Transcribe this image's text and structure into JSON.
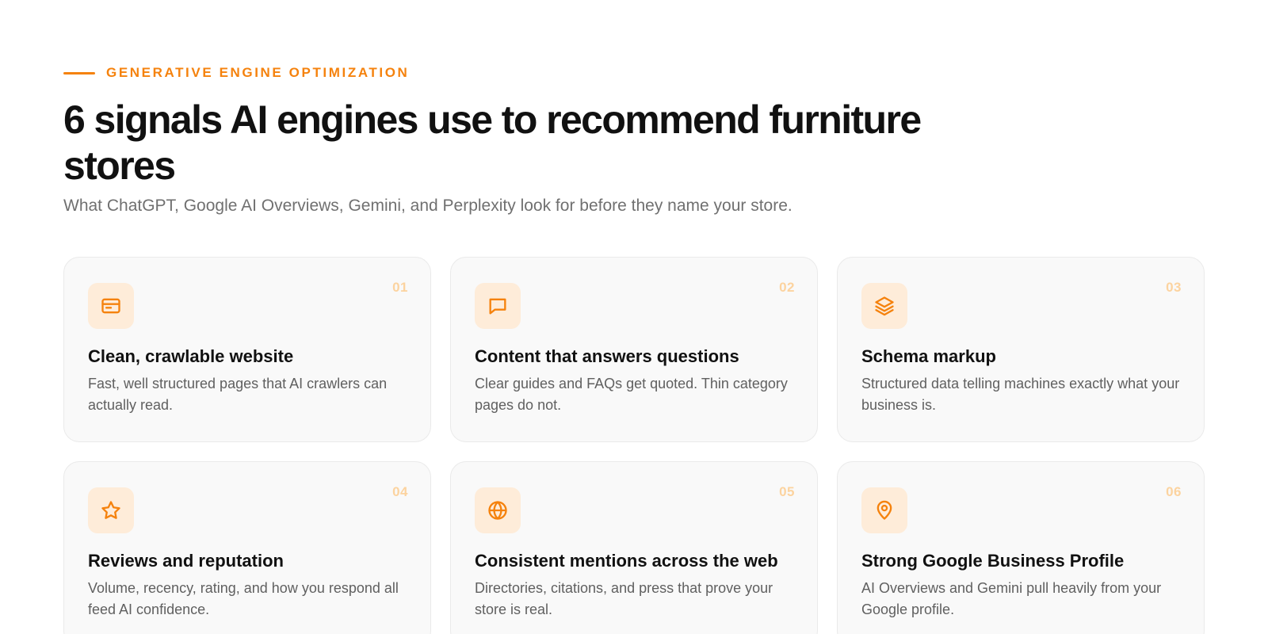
{
  "eyebrow": "GENERATIVE ENGINE OPTIMIZATION",
  "title": "6 signals AI engines use to recommend furniture stores",
  "subtitle": "What ChatGPT, Google AI Overviews, Gemini, and Perplexity look for before they name your store.",
  "colors": {
    "accent": "#f5820d",
    "accent_soft": "#feecd9",
    "number": "#fcd39f",
    "card_bg": "#f9f9f9"
  },
  "cards": [
    {
      "number": "01",
      "icon": "browser-window-icon",
      "title": "Clean, crawlable website",
      "description": "Fast, well structured pages that AI crawlers can actually read."
    },
    {
      "number": "02",
      "icon": "chat-bubble-icon",
      "title": "Content that answers questions",
      "description": "Clear guides and FAQs get quoted. Thin category pages do not."
    },
    {
      "number": "03",
      "icon": "layers-icon",
      "title": "Schema markup",
      "description": "Structured data telling machines exactly what your business is."
    },
    {
      "number": "04",
      "icon": "star-icon",
      "title": "Reviews and reputation",
      "description": "Volume, recency, rating, and how you respond all feed AI confidence."
    },
    {
      "number": "05",
      "icon": "globe-icon",
      "title": "Consistent mentions across the web",
      "description": "Directories, citations, and press that prove your store is real."
    },
    {
      "number": "06",
      "icon": "map-pin-icon",
      "title": "Strong Google Business Profile",
      "description": "AI Overviews and Gemini pull heavily from your Google profile."
    }
  ]
}
